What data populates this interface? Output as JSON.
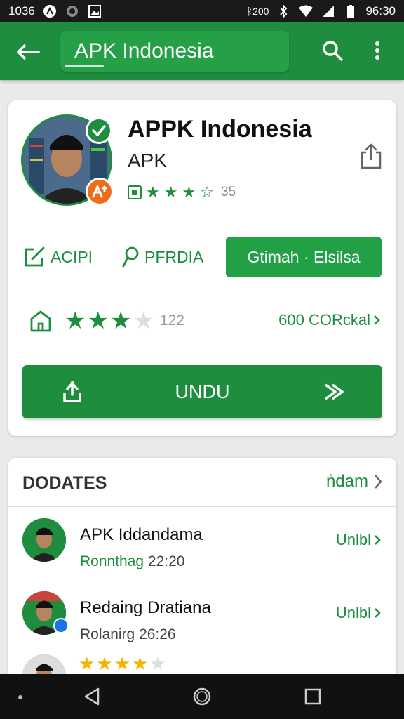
{
  "status_bar": {
    "time_left": "1036",
    "carrier": "ᛒ200",
    "battery_time": "96:30"
  },
  "app_bar": {
    "title": "APK Indonesia"
  },
  "app_card": {
    "name": "APPK Indonesia",
    "developer": "APK",
    "rating_count": "35",
    "action_1_label": "ACIPI",
    "action_2_label": "PFRDIA",
    "pill_button_label": "Gtimah · Elsilsa",
    "stats_count": "122",
    "stats_link": "600 CORckal",
    "download_label": "UNDU"
  },
  "updates": {
    "title": "DODATES",
    "header_link": "ṅdam",
    "items": [
      {
        "name": "APK Iddandama",
        "meta_green": "Ronnthag",
        "meta_time": "22:20",
        "action": "Unlbl"
      },
      {
        "name": "Redaing Dratiana",
        "meta_green": "Rolanirg",
        "meta_time": "26:26",
        "action": "Unlbl"
      }
    ]
  },
  "colors": {
    "brand_green": "#1e8e3e",
    "accent_orange": "#ef6c1a"
  }
}
